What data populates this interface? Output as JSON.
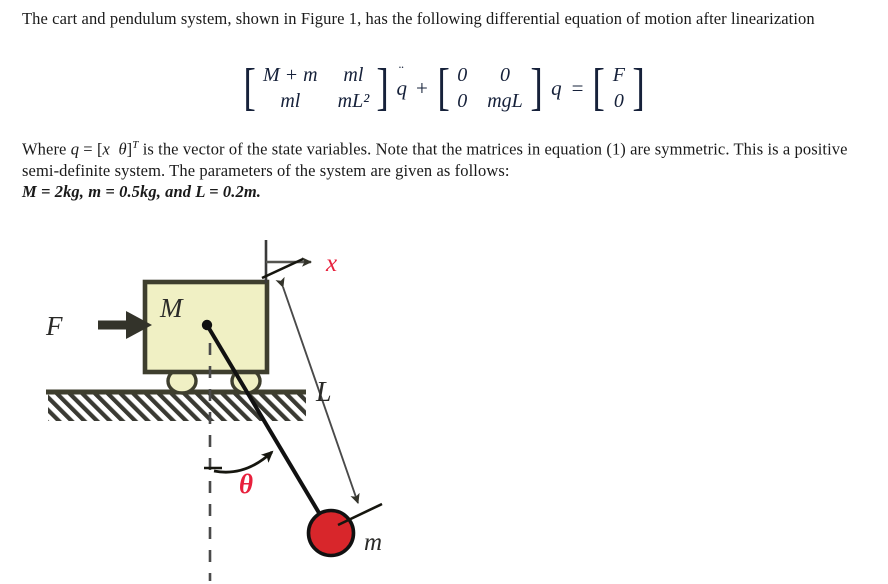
{
  "document": {
    "intro_paragraph": "The cart and pendulum system, shown in Figure 1, has the following differential equation of motion after linearization",
    "where_paragraph_part1": "Where ",
    "where_paragraph_part2": " is the vector of the state variables. Note that the matrices in equation (1) are symmetric. This is a positive semi-definite system. The parameters of the system are given as follows:",
    "state_vector_inline": {
      "q": "q",
      "equals": "=",
      "open_bracket": "[",
      "x": "x",
      "theta": "θ",
      "close_bracket": "]",
      "transpose": "T"
    },
    "parameters_line": {
      "M_symbol": "M",
      "M_value": "2kg",
      "m_symbol": "m",
      "m_value": "0.5kg",
      "and_word": "and",
      "L_symbol": "L",
      "L_value": "0.2m",
      "full_text": "M = 2kg, m = 0.5kg, and L = 0.2m."
    }
  },
  "equation": {
    "mass_matrix": {
      "row1": [
        "M + m",
        "ml"
      ],
      "row2": [
        "ml",
        "mL²"
      ]
    },
    "acceleration_symbol": "q",
    "acceleration_dots": "¨",
    "plus_operator": "+",
    "stiffness_matrix": {
      "row1": [
        "0",
        "0"
      ],
      "row2": [
        "0",
        "mgL"
      ]
    },
    "state_symbol": "q",
    "equals_operator": "=",
    "force_vector": [
      "F",
      "0"
    ],
    "left_bracket": "[",
    "right_bracket": "]"
  },
  "figure": {
    "labels": {
      "cart_mass": "M",
      "force": "F",
      "displacement": "x",
      "rod_length": "L",
      "angle": "θ",
      "bob_mass": "m"
    },
    "colors": {
      "cart_fill": "#f0f0c4",
      "cart_stroke": "#3e3e2e",
      "ground_stroke": "#3e3e2e",
      "bob_fill": "#d8262b",
      "bob_stroke": "#111111",
      "arrow_dark": "#33332a",
      "accent_red": "#e8203c",
      "label_dark": "#2a2a28",
      "thin_line": "#4a4a4a"
    }
  }
}
